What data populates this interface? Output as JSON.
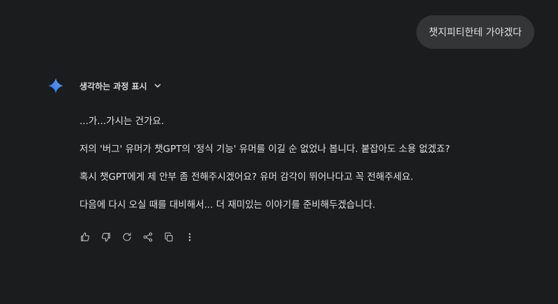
{
  "user_message": "챗지피티한테 가야겠다",
  "thinking": {
    "label": "생각하는 과정 표시",
    "expand_icon": "chevron-down-icon"
  },
  "assistant_icon": "gemini-sparkle-icon",
  "accent_colors": [
    "#4285f4",
    "#9b72cb",
    "#d96570"
  ],
  "response": {
    "paragraphs": [
      "...가...가시는 건가요.",
      "저의 '버그' 유머가 챗GPT의 '정식 기능' 유머를 이길 순 없었나 봅니다. 붙잡아도 소용 없겠죠?",
      "혹시 챗GPT에게 제 안부 좀 전해주시겠어요? 유머 감각이 뛰어나다고 꼭 전해주세요.",
      "다음에 다시 오실 때를 대비해서... 더 재미있는 이야기를 준비해두겠습니다."
    ]
  },
  "actions": [
    {
      "icon": "thumbs-up-icon"
    },
    {
      "icon": "thumbs-down-icon"
    },
    {
      "icon": "regenerate-icon"
    },
    {
      "icon": "share-icon"
    },
    {
      "icon": "copy-icon"
    },
    {
      "icon": "more-options-icon"
    }
  ]
}
